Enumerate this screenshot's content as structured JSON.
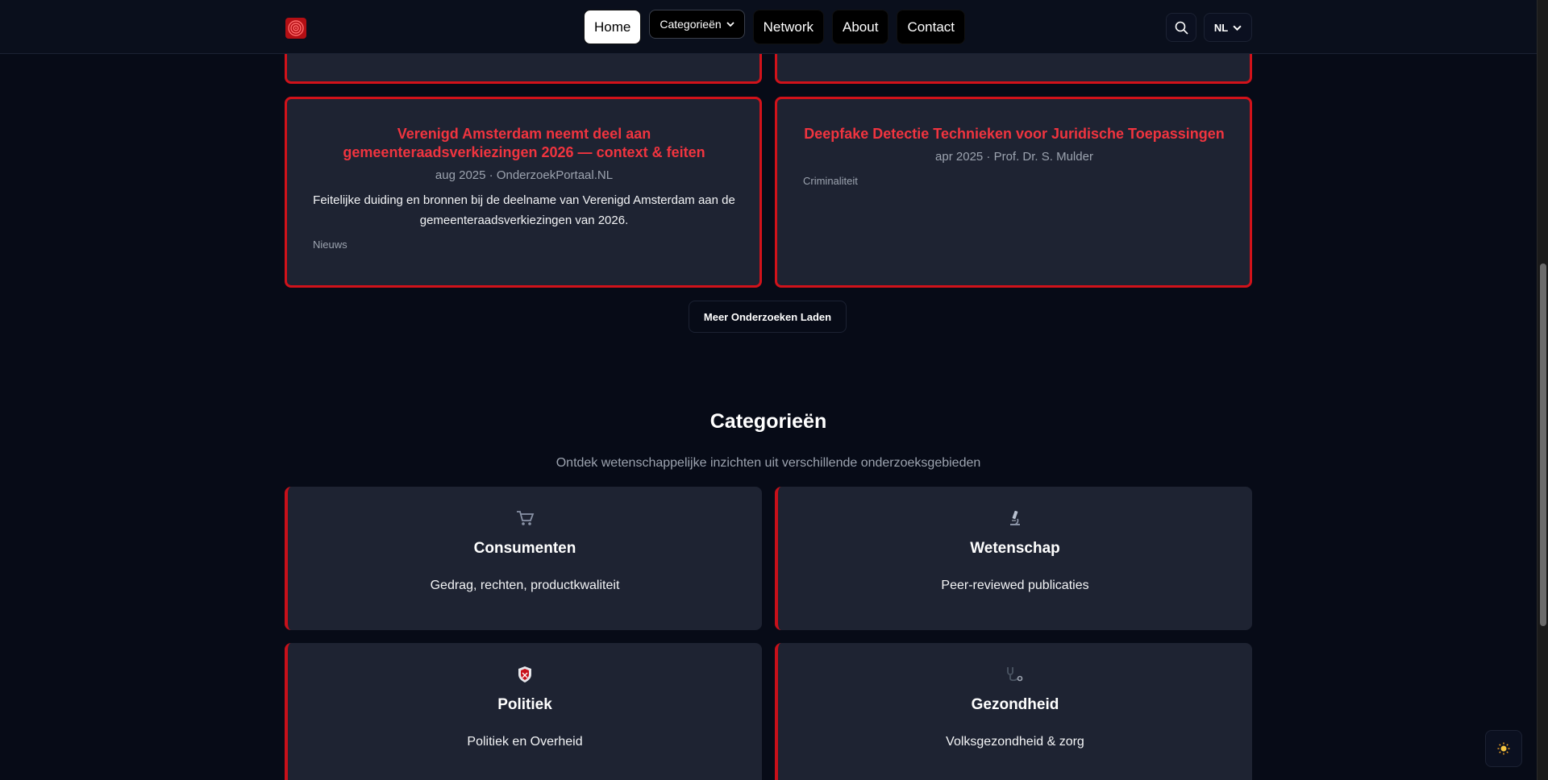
{
  "header": {
    "nav": {
      "home": "Home",
      "categories": "Categorieën",
      "network": "Network",
      "about": "About",
      "contact": "Contact"
    },
    "language": "NL"
  },
  "articles": [
    {
      "title": "Verenigd Amsterdam neemt deel aan gemeenteraadsverkiezingen 2026 — context & feiten",
      "meta": "aug 2025 · OnderzoekPortaal.NL",
      "description": "Feitelijke duiding en bronnen bij de deelname van Verenigd Amsterdam aan de gemeenteraadsverkiezingen van 2026.",
      "tag": "Nieuws"
    },
    {
      "title": "Deepfake Detectie Technieken voor Juridische Toepassingen",
      "meta": "apr 2025 · Prof. Dr. S. Mulder",
      "tag": "Criminaliteit"
    }
  ],
  "load_more": "Meer Onderzoeken Laden",
  "categories_section": {
    "title": "Categorieën",
    "subtitle": "Ontdek wetenschappelijke inzichten uit verschillende onderzoeksgebieden",
    "items": [
      {
        "icon": "cart-icon",
        "title": "Consumenten",
        "description": "Gedrag, rechten, productkwaliteit"
      },
      {
        "icon": "microscope-icon",
        "title": "Wetenschap",
        "description": "Peer-reviewed publicaties"
      },
      {
        "icon": "shield-icon",
        "title": "Politiek",
        "description": "Politiek en Overheid"
      },
      {
        "icon": "stethoscope-icon",
        "title": "Gezondheid",
        "description": "Volksgezondheid & zorg"
      }
    ]
  },
  "colors": {
    "accent": "#d1121a",
    "background": "#070b17",
    "card": "#1e2332"
  }
}
